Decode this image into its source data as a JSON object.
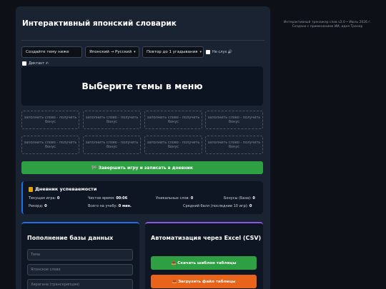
{
  "app": {
    "title": "Интерактивный японский словарик"
  },
  "controls": {
    "topic_input_placeholder": "Создайте тему ниже",
    "direction_select": "Японский → Русский",
    "repeat_select": "Повтор до 1 угадывания",
    "no_sound_label": "Не слух 🔊",
    "dictation_label": "Диктант ✍"
  },
  "display": {
    "message": "Выберите темы в меню"
  },
  "slots": [
    "заполнить слово - получить бонус",
    "заполнить слово - получить бонус",
    "заполнить слово - получить бонус",
    "заполнить слово - получить бонус",
    "заполнить слово - получить бонус",
    "заполнить слово - получить бонус",
    "заполнить слово - получить бонус",
    "заполнить слово - получить бонус"
  ],
  "finish_button": "🏁 Завершить игру и записать в дневник",
  "diary": {
    "title": "Дневник успеваемости",
    "current_game_label": "Текущая игра:",
    "current_game_value": "0",
    "clean_time_label": "Чистое время:",
    "clean_time_value": "00:06",
    "unique_words_label": "Уникальных слов:",
    "unique_words_value": "0",
    "bonuses_label": "Бонусы (База):",
    "bonuses_value": "0",
    "record_label": "Рекорд:",
    "record_value": "0",
    "total_study_label": "Всего на учебу:",
    "total_study_value": "0 мин.",
    "avg_score_label": "Средний балл (последние 10 игр):",
    "avg_score_value": "0"
  },
  "db_card": {
    "title": "Пополнение базы данных",
    "topic_placeholder": "Тема",
    "japanese_placeholder": "Японское слово",
    "hiragana_placeholder": "Хирагана (транскрипция)"
  },
  "excel_card": {
    "title": "Автоматизация через Excel (CSV)",
    "download_button": "📥 Скачать шаблон таблицы",
    "upload_button": "📤 Загрузить файл таблицы"
  },
  "footer": {
    "line1": "Интерактивный тренажер слов v2.0 • Июль 2026 г.",
    "line2": "Создано с применением ИИ, идея Тренер"
  },
  "colors": {
    "background": "#0d1117",
    "panel": "#1a2332",
    "accent_green": "#2ea043",
    "accent_orange": "#e8641b",
    "accent_blue": "#1f6feb",
    "accent_purple": "#8957e5"
  }
}
